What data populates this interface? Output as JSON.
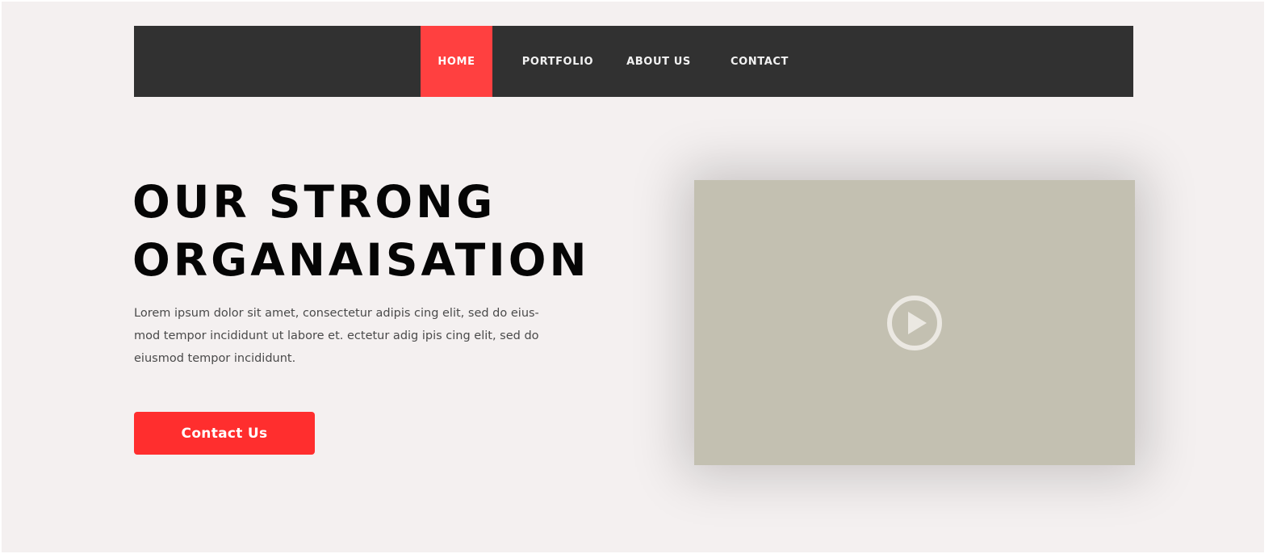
{
  "nav": {
    "items": [
      {
        "label": "HOME",
        "active": true
      },
      {
        "label": "PORTFOLIO",
        "active": false
      },
      {
        "label": "ABOUT US",
        "active": false
      },
      {
        "label": "CONTACT",
        "active": false
      }
    ]
  },
  "hero": {
    "title_line1": "OUR STRONG",
    "title_line2": "ORGANAISATION",
    "description": "Lorem ipsum dolor sit amet, consectetur adipis cing elit, sed do eius-mod tempor incididunt  ut labore et. ectetur adig ipis cing elit, sed do eiusmod tempor incididunt.",
    "cta_label": "Contact Us"
  },
  "video": {
    "icon": "play-icon"
  },
  "colors": {
    "page_background": "#f4f0f0",
    "navbar": "#313131",
    "nav_active": "#ff4040",
    "button": "#ff2e2e",
    "video_placeholder": "#c3c0b1",
    "play_icon": "#ebe8e2"
  }
}
